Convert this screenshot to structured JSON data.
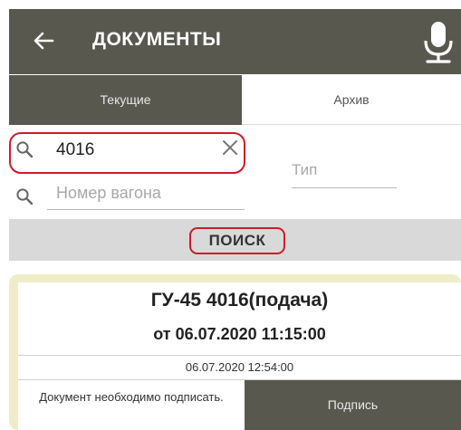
{
  "appbar": {
    "title": "ДОКУМЕНТЫ",
    "back_icon": "arrow-left-icon",
    "mic_icon": "microphone-icon",
    "background": "#58584f"
  },
  "tabs": [
    {
      "label": "Текущие",
      "selected": true
    },
    {
      "label": "Архив",
      "selected": false
    }
  ],
  "search": {
    "document_number": {
      "value": "4016",
      "icon": "search-icon",
      "clear_icon": "close-icon"
    },
    "wagon_number": {
      "value": "",
      "placeholder": "Номер вагона",
      "icon": "search-icon"
    },
    "type": {
      "value": "",
      "placeholder": "Тип"
    },
    "button_label": "ПОИСК"
  },
  "documents": [
    {
      "title": "ГУ-45 4016(подача)",
      "subtitle": "от 06.07.2020 11:15:00",
      "date": "06.07.2020 12:54:00",
      "status": "Документ необходимо подписать.",
      "sign_label": "Подпись"
    }
  ],
  "colors": {
    "highlight": "#d11a2a",
    "card_border": "#eeedc8",
    "dark": "#58584f"
  }
}
